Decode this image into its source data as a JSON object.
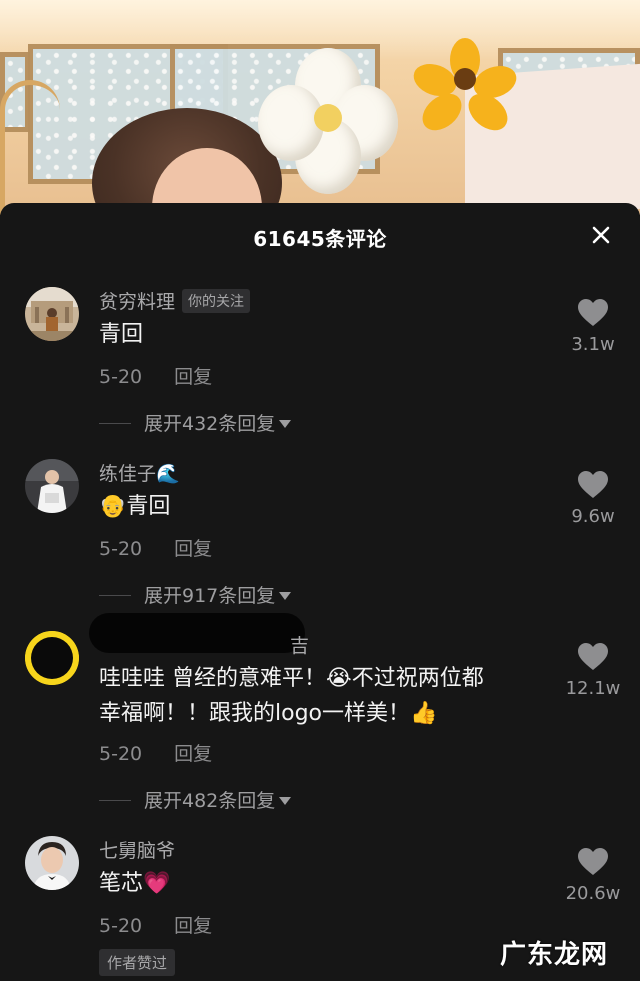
{
  "panel": {
    "title": "61645条评论",
    "close_icon": "close-icon"
  },
  "comments": [
    {
      "username": "贫穷料理",
      "badge": "你的关注",
      "text": "青回",
      "date": "5-20",
      "reply_label": "回复",
      "likes": "3.1w",
      "expand_label": "展开432条回复"
    },
    {
      "username": "练佳子🌊",
      "text": "👴青回",
      "date": "5-20",
      "reply_label": "回复",
      "likes": "9.6w",
      "expand_label": "展开917条回复"
    },
    {
      "username_suffix": "吉",
      "text_line1": "哇哇哇 曾经的意难平！😭不过祝两位都",
      "text_line2": "幸福啊！！跟我的logo一样美！👍",
      "date": "5-20",
      "reply_label": "回复",
      "likes": "12.1w",
      "expand_label": "展开482条回复"
    },
    {
      "username": "七舅脑爷",
      "text": "笔芯💗",
      "date": "5-20",
      "reply_label": "回复",
      "likes": "20.6w",
      "author_badge": "作者赞过"
    }
  ],
  "watermark": "广东龙网",
  "colors": {
    "panel_bg": "#161616",
    "text_primary": "#f2f2f2",
    "text_secondary": "#a9a9ab",
    "avatar3_ring": "#f7d51c"
  }
}
